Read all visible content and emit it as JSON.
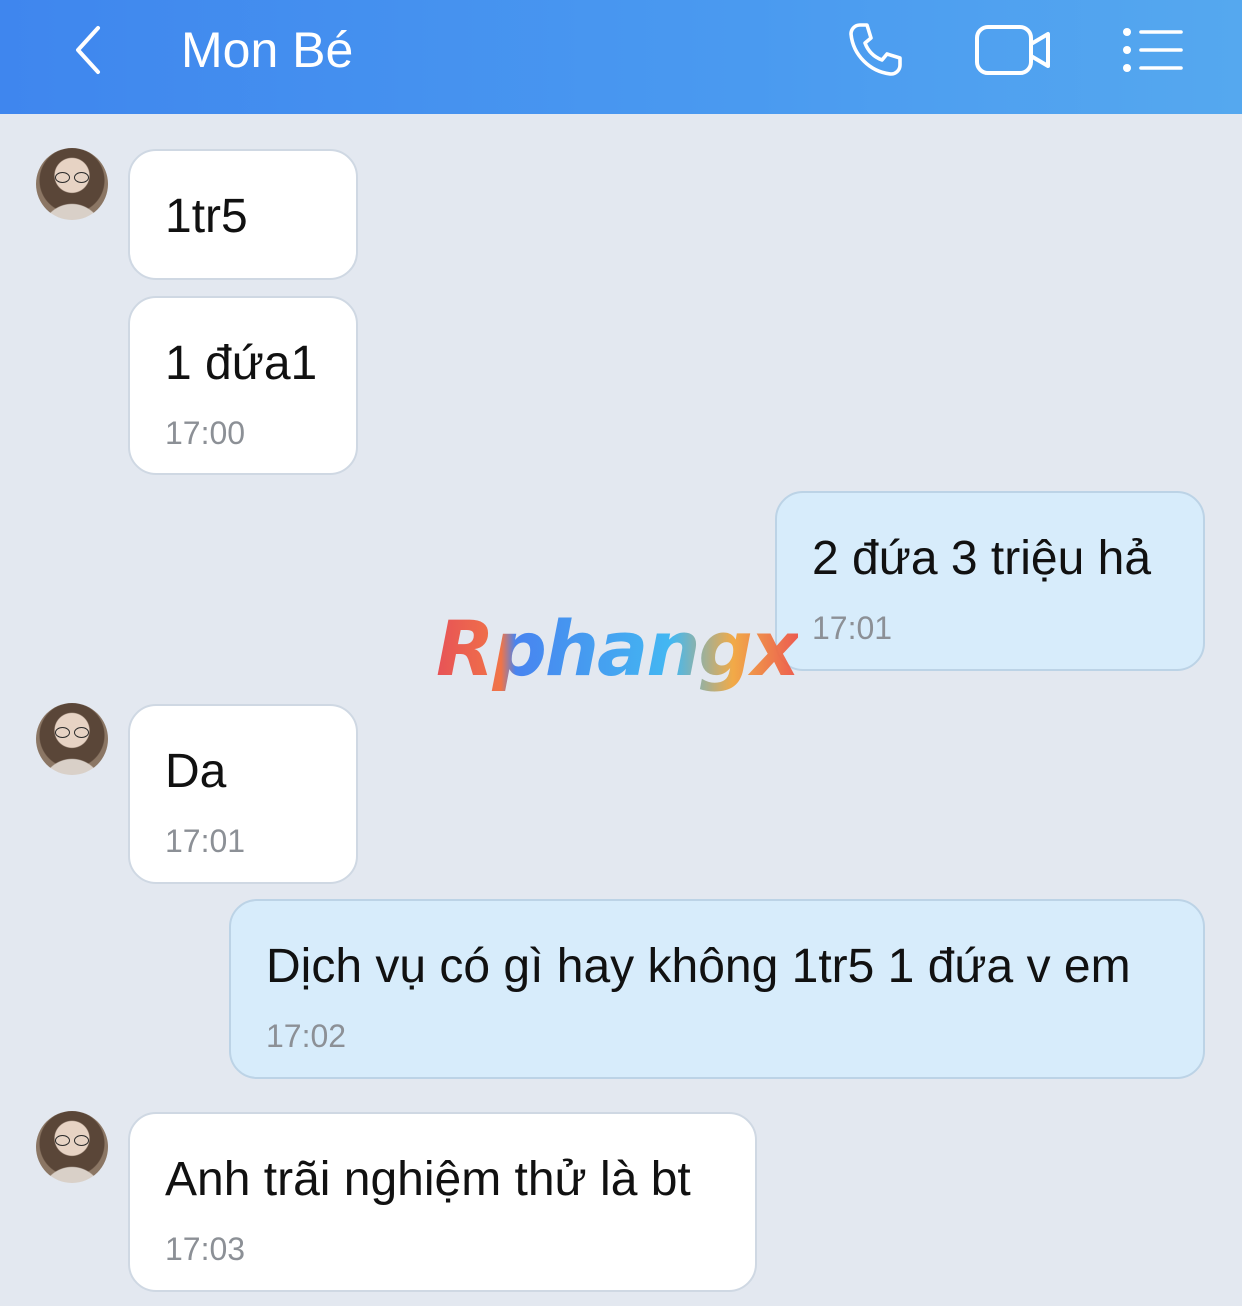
{
  "header": {
    "title": "Mon Bé",
    "icons": [
      "back-chevron",
      "phone-icon",
      "video-camera-icon",
      "list-menu-icon"
    ],
    "gradient": [
      "#3f86ee",
      "#55a8ef"
    ]
  },
  "messages": [
    {
      "direction": "incoming",
      "text": "1tr5",
      "time": ""
    },
    {
      "direction": "incoming",
      "text": "1 đứa1",
      "time": "17:00"
    },
    {
      "direction": "outgoing",
      "text": "2 đứa 3 triệu hả",
      "time": "17:01"
    },
    {
      "direction": "incoming",
      "text": "Da",
      "time": "17:01"
    },
    {
      "direction": "outgoing",
      "text": "Dịch vụ có gì hay không 1tr5 1 đứa v em",
      "time": "17:02"
    },
    {
      "direction": "incoming",
      "text": "Anh trãi nghiệm thử là bt",
      "time": "17:03"
    }
  ],
  "watermark": "Rphangx",
  "colors": {
    "background": "#e3e8f0",
    "incoming_bubble": "#ffffff",
    "outgoing_bubble": "#d7ecfb",
    "time_text": "#8c9096"
  }
}
